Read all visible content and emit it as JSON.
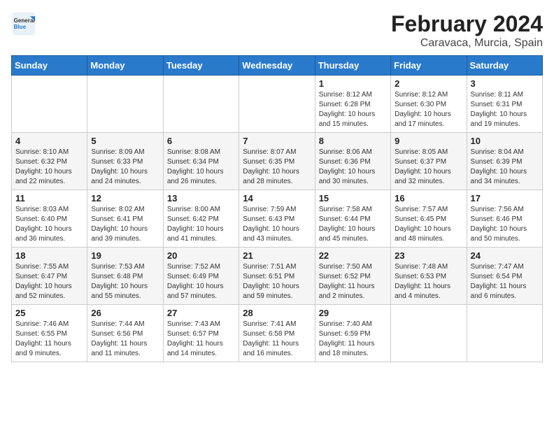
{
  "header": {
    "logo_general": "General",
    "logo_blue": "Blue",
    "title": "February 2024",
    "subtitle": "Caravaca, Murcia, Spain"
  },
  "weekdays": [
    "Sunday",
    "Monday",
    "Tuesday",
    "Wednesday",
    "Thursday",
    "Friday",
    "Saturday"
  ],
  "weeks": [
    [
      {
        "day": "",
        "info": ""
      },
      {
        "day": "",
        "info": ""
      },
      {
        "day": "",
        "info": ""
      },
      {
        "day": "",
        "info": ""
      },
      {
        "day": "1",
        "info": "Sunrise: 8:12 AM\nSunset: 6:28 PM\nDaylight: 10 hours\nand 15 minutes."
      },
      {
        "day": "2",
        "info": "Sunrise: 8:12 AM\nSunset: 6:30 PM\nDaylight: 10 hours\nand 17 minutes."
      },
      {
        "day": "3",
        "info": "Sunrise: 8:11 AM\nSunset: 6:31 PM\nDaylight: 10 hours\nand 19 minutes."
      }
    ],
    [
      {
        "day": "4",
        "info": "Sunrise: 8:10 AM\nSunset: 6:32 PM\nDaylight: 10 hours\nand 22 minutes."
      },
      {
        "day": "5",
        "info": "Sunrise: 8:09 AM\nSunset: 6:33 PM\nDaylight: 10 hours\nand 24 minutes."
      },
      {
        "day": "6",
        "info": "Sunrise: 8:08 AM\nSunset: 6:34 PM\nDaylight: 10 hours\nand 26 minutes."
      },
      {
        "day": "7",
        "info": "Sunrise: 8:07 AM\nSunset: 6:35 PM\nDaylight: 10 hours\nand 28 minutes."
      },
      {
        "day": "8",
        "info": "Sunrise: 8:06 AM\nSunset: 6:36 PM\nDaylight: 10 hours\nand 30 minutes."
      },
      {
        "day": "9",
        "info": "Sunrise: 8:05 AM\nSunset: 6:37 PM\nDaylight: 10 hours\nand 32 minutes."
      },
      {
        "day": "10",
        "info": "Sunrise: 8:04 AM\nSunset: 6:39 PM\nDaylight: 10 hours\nand 34 minutes."
      }
    ],
    [
      {
        "day": "11",
        "info": "Sunrise: 8:03 AM\nSunset: 6:40 PM\nDaylight: 10 hours\nand 36 minutes."
      },
      {
        "day": "12",
        "info": "Sunrise: 8:02 AM\nSunset: 6:41 PM\nDaylight: 10 hours\nand 39 minutes."
      },
      {
        "day": "13",
        "info": "Sunrise: 8:00 AM\nSunset: 6:42 PM\nDaylight: 10 hours\nand 41 minutes."
      },
      {
        "day": "14",
        "info": "Sunrise: 7:59 AM\nSunset: 6:43 PM\nDaylight: 10 hours\nand 43 minutes."
      },
      {
        "day": "15",
        "info": "Sunrise: 7:58 AM\nSunset: 6:44 PM\nDaylight: 10 hours\nand 45 minutes."
      },
      {
        "day": "16",
        "info": "Sunrise: 7:57 AM\nSunset: 6:45 PM\nDaylight: 10 hours\nand 48 minutes."
      },
      {
        "day": "17",
        "info": "Sunrise: 7:56 AM\nSunset: 6:46 PM\nDaylight: 10 hours\nand 50 minutes."
      }
    ],
    [
      {
        "day": "18",
        "info": "Sunrise: 7:55 AM\nSunset: 6:47 PM\nDaylight: 10 hours\nand 52 minutes."
      },
      {
        "day": "19",
        "info": "Sunrise: 7:53 AM\nSunset: 6:48 PM\nDaylight: 10 hours\nand 55 minutes."
      },
      {
        "day": "20",
        "info": "Sunrise: 7:52 AM\nSunset: 6:49 PM\nDaylight: 10 hours\nand 57 minutes."
      },
      {
        "day": "21",
        "info": "Sunrise: 7:51 AM\nSunset: 6:51 PM\nDaylight: 10 hours\nand 59 minutes."
      },
      {
        "day": "22",
        "info": "Sunrise: 7:50 AM\nSunset: 6:52 PM\nDaylight: 11 hours\nand 2 minutes."
      },
      {
        "day": "23",
        "info": "Sunrise: 7:48 AM\nSunset: 6:53 PM\nDaylight: 11 hours\nand 4 minutes."
      },
      {
        "day": "24",
        "info": "Sunrise: 7:47 AM\nSunset: 6:54 PM\nDaylight: 11 hours\nand 6 minutes."
      }
    ],
    [
      {
        "day": "25",
        "info": "Sunrise: 7:46 AM\nSunset: 6:55 PM\nDaylight: 11 hours\nand 9 minutes."
      },
      {
        "day": "26",
        "info": "Sunrise: 7:44 AM\nSunset: 6:56 PM\nDaylight: 11 hours\nand 11 minutes."
      },
      {
        "day": "27",
        "info": "Sunrise: 7:43 AM\nSunset: 6:57 PM\nDaylight: 11 hours\nand 14 minutes."
      },
      {
        "day": "28",
        "info": "Sunrise: 7:41 AM\nSunset: 6:58 PM\nDaylight: 11 hours\nand 16 minutes."
      },
      {
        "day": "29",
        "info": "Sunrise: 7:40 AM\nSunset: 6:59 PM\nDaylight: 11 hours\nand 18 minutes."
      },
      {
        "day": "",
        "info": ""
      },
      {
        "day": "",
        "info": ""
      }
    ]
  ]
}
